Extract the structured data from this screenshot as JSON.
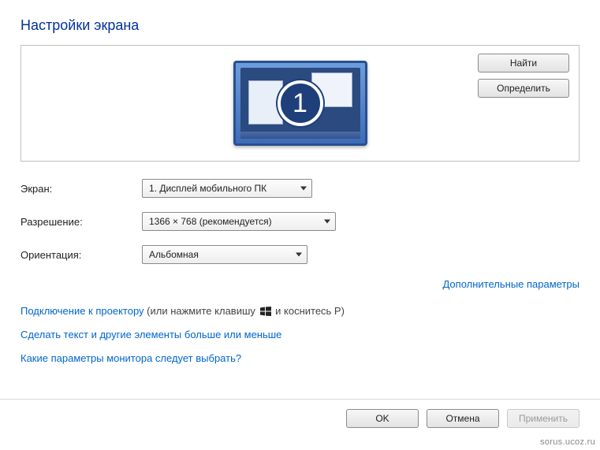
{
  "title": "Настройки экрана",
  "preview": {
    "detect_label": "Найти",
    "identify_label": "Определить",
    "monitor_number": "1"
  },
  "fields": {
    "display": {
      "label": "Экран:",
      "value": "1. Дисплей мобильного ПК"
    },
    "resolution": {
      "label": "Разрешение:",
      "value": "1366 × 768 (рекомендуется)"
    },
    "orientation": {
      "label": "Ориентация:",
      "value": "Альбомная"
    }
  },
  "links": {
    "advanced": "Дополнительные параметры",
    "projector_link": "Подключение к проектору",
    "projector_suffix_a": " (или нажмите клавишу ",
    "projector_suffix_b": " и коснитесь P)",
    "text_size": "Сделать текст и другие элементы больше или меньше",
    "help": "Какие параметры монитора следует выбрать?"
  },
  "buttons": {
    "ok": "OK",
    "cancel": "Отмена",
    "apply": "Применить"
  },
  "watermark": "sorus.ucoz.ru"
}
